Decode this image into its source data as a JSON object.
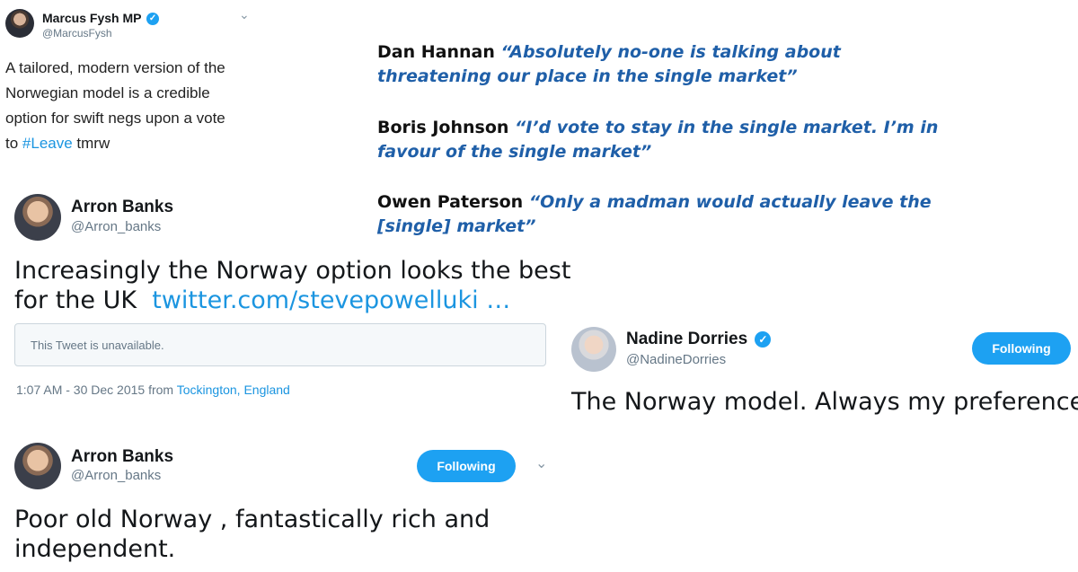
{
  "tweet1": {
    "name": "Marcus Fysh MP",
    "handle": "@MarcusFysh",
    "text_part1": "A tailored, modern version of the",
    "text_part2": "Norwegian model is a credible",
    "text_part3": "option for swift negs upon a vote",
    "text_part4_prefix": "to ",
    "hashtag": "#Leave",
    "text_part4_suffix": " tmrw"
  },
  "quotes": [
    {
      "speaker": "Dan Hannan",
      "line1": "“Absolutely no-one is talking about",
      "line2": "threatening our place in the single market”"
    },
    {
      "speaker": "Boris Johnson",
      "line1": "“I’d vote to stay in the single market. I’m in",
      "line2": "favour of the single market”"
    },
    {
      "speaker": "Owen Paterson",
      "line1": "“Only a madman would actually leave the",
      "line2": "[single] market”"
    }
  ],
  "tweet2": {
    "name": "Arron Banks",
    "handle": "@Arron_banks",
    "text_line1": "Increasingly the Norway option looks the best",
    "text_line2": "for the UK",
    "link": "twitter.com/stevepowelluki …",
    "unavailable": "This Tweet is unavailable.",
    "timestamp": "1:07 AM - 30 Dec 2015 from ",
    "location": "Tockington, England"
  },
  "tweet3": {
    "name": "Nadine Dorries",
    "handle": "@NadineDorries",
    "follow_label": "Following",
    "text": "The Norway model. Always my preference"
  },
  "tweet4": {
    "name": "Arron Banks",
    "handle": "@Arron_banks",
    "follow_label": "Following",
    "text_line1": "Poor old Norway , fantastically rich and",
    "text_line2": "independent."
  },
  "icons": {
    "verified": "✓",
    "chevron": "⌄"
  },
  "colors": {
    "link": "#1b95e0",
    "follow_button": "#1da1f2",
    "quote_text": "#1f5fa8"
  }
}
